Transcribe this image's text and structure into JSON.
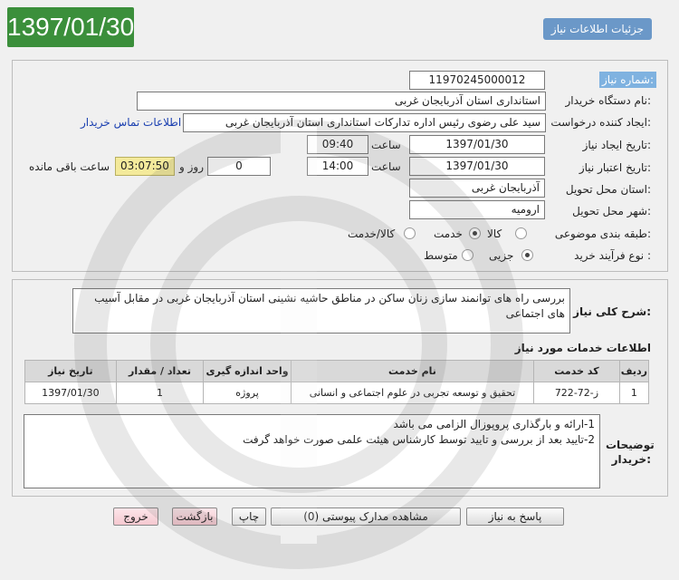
{
  "header": {
    "date": "1397/01/30",
    "tab_label": "جزئیات اطلاعات نیاز"
  },
  "form": {
    "need_number": {
      "label": "شماره نیاز:",
      "value": "1197024500001​2"
    },
    "buyer_org": {
      "label": "نام دستگاه خریدار:",
      "value": "استانداری استان آذربایجان غربی"
    },
    "requester": {
      "label": "ایجاد کننده درخواست:",
      "value": "سید علی رضوی رئیس اداره تدارکات استانداری استان آذربایجان غربی",
      "contact_link": "اطلاعات تماس خریدار"
    },
    "created": {
      "label": "تاریخ ایجاد نیاز:",
      "date": "1397/01/30",
      "time_label": "ساعت",
      "time": "09:40"
    },
    "validity": {
      "label": "تاریخ اعتبار نیاز:",
      "date": "1397/01/30",
      "time_label": "ساعت",
      "time": "14:00",
      "days": "0",
      "days_label": "روز و",
      "remaining": "03:07:50",
      "remaining_label": "ساعت باقی مانده"
    },
    "delivery_province": {
      "label": "استان محل تحویل:",
      "value": "آذربایجان غربی"
    },
    "delivery_city": {
      "label": "شهر محل تحویل:",
      "value": "ارومیه"
    },
    "category": {
      "label": "طبقه بندی موضوعی:",
      "options": [
        "کالا",
        "خدمت",
        "کالا/خدمت"
      ],
      "selected": "خدمت"
    },
    "process_type": {
      "label": "نوع فرآیند خرید :",
      "options": [
        "جزیی",
        "متوسط"
      ],
      "selected": "جزیی"
    }
  },
  "details": {
    "summary_label": "شرح کلی نیاز:",
    "summary": "بررسی راه های توانمند سازی زنان ساکن در مناطق حاشیه نشینی استان آذربایجان غربی در مقابل آسیب های اجتماعی",
    "services_title": "اطلاعات خدمات مورد نیاز",
    "table": {
      "headers": [
        "ردیف",
        "کد خدمت",
        "نام خدمت",
        "واحد اندازه گیری",
        "تعداد / مقدار",
        "تاریخ نیاز"
      ],
      "rows": [
        [
          "1",
          "ز-72-722",
          "تحقیق و توسعه تجربی در علوم اجتماعی و انسانی",
          "پروژه",
          "1",
          "1397/01/30"
        ]
      ]
    },
    "notes_label": "توضیحات خریدار:",
    "notes": [
      "1-ارائه و بارگذاری پروپوزال الزامی می باشد",
      "2-تایید بعد از بررسی و تایید توسط کارشناس هیئت علمی صورت خواهد گرفت"
    ]
  },
  "buttons": {
    "reply": "پاسخ به نیاز",
    "attachments": "مشاهده مدارک پیوستی (0)",
    "print": "چاپ",
    "back": "بازگشت",
    "exit": "خروج"
  },
  "colors": {
    "date_badge": "#3b8f3b",
    "tab": "#6b98c8",
    "timer": "#f4ea9b",
    "pink_button": "#f5c8d0"
  }
}
